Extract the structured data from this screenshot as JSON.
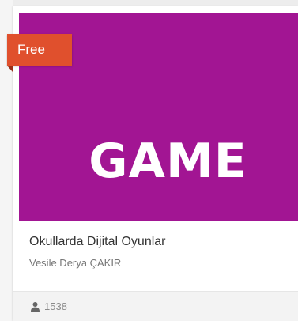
{
  "card": {
    "badge": "Free",
    "thumbnail": {
      "text": "GAME",
      "background": "#a21593",
      "text_color": "#ffffff"
    },
    "title": "Okullarda Dijital Oyunlar",
    "author": "Vesile Derya ÇAKIR",
    "enrolled_count": "1538",
    "enrolled_icon": "user-icon",
    "badge_color": "#e0502d"
  }
}
